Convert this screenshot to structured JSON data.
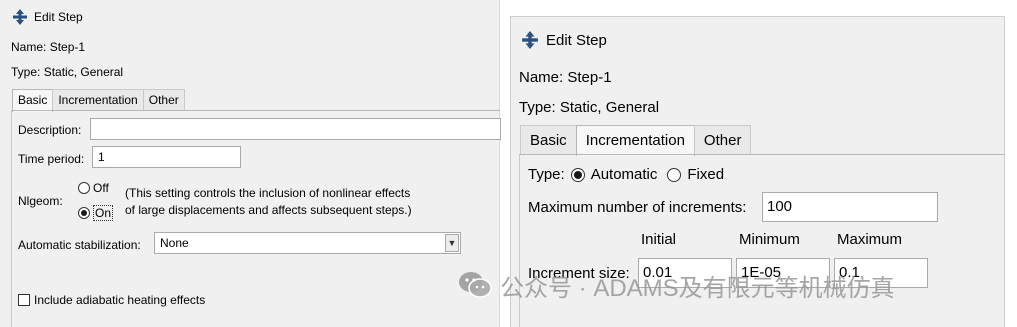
{
  "left_dialog": {
    "title": "Edit Step",
    "name_label": "Name:",
    "name_value": "Step-1",
    "type_label": "Type:",
    "type_value": "Static, General",
    "tabs": [
      {
        "label": "Basic",
        "active": true
      },
      {
        "label": "Incrementation",
        "active": false
      },
      {
        "label": "Other",
        "active": false
      }
    ],
    "description_label": "Description:",
    "description_value": "",
    "time_period_label": "Time period:",
    "time_period_value": "1",
    "nlgeom_label": "Nlgeom:",
    "nlgeom_off_label": "Off",
    "nlgeom_on_label": "On",
    "nlgeom_selected": "On",
    "nlgeom_note_line1": "(This setting controls the inclusion of nonlinear effects",
    "nlgeom_note_line2": "of large displacements and affects subsequent steps.)",
    "stabilization_label": "Automatic stabilization:",
    "stabilization_value": "None",
    "adiabatic_label": "Include adiabatic heating effects",
    "adiabatic_checked": false
  },
  "right_dialog": {
    "title": "Edit Step",
    "name_label": "Name:",
    "name_value": "Step-1",
    "type_label": "Type:",
    "type_value": "Static, General",
    "tabs": [
      {
        "label": "Basic",
        "active": false
      },
      {
        "label": "Incrementation",
        "active": true
      },
      {
        "label": "Other",
        "active": false
      }
    ],
    "incr_type_label": "Type:",
    "incr_type_automatic": "Automatic",
    "incr_type_fixed": "Fixed",
    "incr_type_selected": "Automatic",
    "max_increments_label": "Maximum number of increments:",
    "max_increments_value": "100",
    "col_initial": "Initial",
    "col_minimum": "Minimum",
    "col_maximum": "Maximum",
    "increment_size_label": "Increment size:",
    "increment_initial": "0.01",
    "increment_minimum": "1E-05",
    "increment_maximum": "0.1"
  },
  "watermark": {
    "text": "公众号 · ADAMS及有限元等机械仿真",
    "icon": "wechat-icon"
  },
  "colors": {
    "dialog_bg": "#f0f0f0",
    "input_bg": "#ffffff",
    "arrow_icon": "#2b4f7e",
    "watermark": "#969696"
  }
}
